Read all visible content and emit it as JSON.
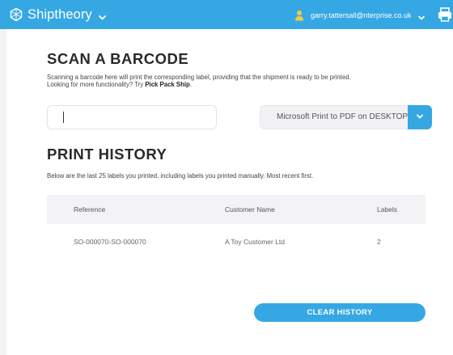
{
  "header": {
    "brand": "Shiptheory",
    "brand_icon": "shiptheory-logo-icon",
    "user_email": "garry.tattersall@nterprise.co.uk",
    "print_icon": "printer-icon",
    "accent_color": "#35a8e4"
  },
  "scan": {
    "title": "SCAN A BARCODE",
    "description_line1": "Scanning a barcode here will print the corresponding label, providing that the shipment is ready to be printed.",
    "description_line2_prefix": "Looking for more functionality? Try ",
    "description_link": "Pick Pack Ship",
    "description_line2_suffix": ".",
    "input_value": "",
    "printer_selected": "Microsoft Print to PDF on DESKTOP"
  },
  "history": {
    "title": "PRINT HISTORY",
    "description": "Below are the last 25 labels you printed, including labels you printed manually. Most recent first.",
    "columns": [
      "Reference",
      "Customer Name",
      "Labels"
    ],
    "rows": [
      {
        "reference": "SO-000070-SO-000070",
        "customer": "A Toy Customer Ltd",
        "labels": "2"
      }
    ],
    "clear_button": "CLEAR HISTORY"
  }
}
